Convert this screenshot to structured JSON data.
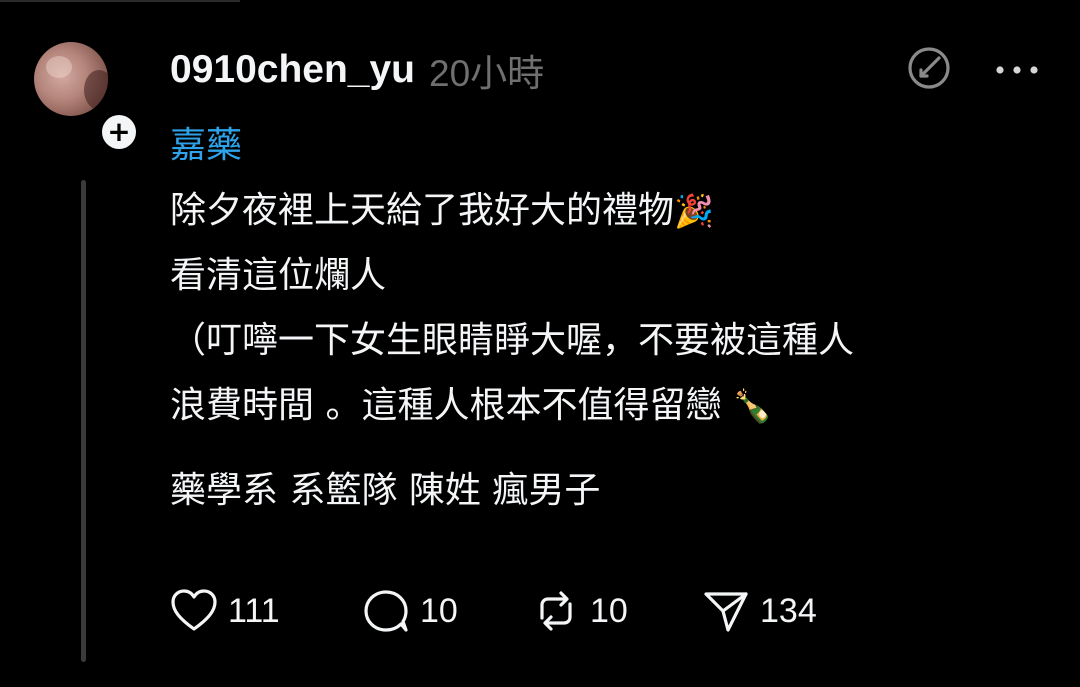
{
  "post": {
    "username": "0910chen_yu",
    "timestamp": "20小時",
    "tag": "嘉藥",
    "body_lines": [
      "除夕夜裡上天給了我好大的禮物",
      "看清這位爛人",
      "（叮嚀一下女生眼睛睜大喔，不要被這種人",
      "浪費時間 。這種人根本不值得留戀"
    ],
    "body_emojis": [
      "🎉",
      "🍾"
    ],
    "hashtags_line": "藥學系 系籃隊 陳姓 瘋男子"
  },
  "actions": {
    "likes": "111",
    "comments": "10",
    "reposts": "10",
    "shares": "134"
  },
  "icons": {
    "avatar": "avatar-photo",
    "follow": "plus-icon",
    "translate": "translate-icon",
    "more": "more-horizontal-icon",
    "like": "heart-icon",
    "comment": "comment-icon",
    "repost": "repost-icon",
    "share": "send-icon"
  },
  "colors": {
    "background": "#000000",
    "text": "#f3f5f7",
    "muted": "#6f6f6f",
    "tag": "#2ea3ea",
    "thread_line": "#3a3a3a"
  }
}
